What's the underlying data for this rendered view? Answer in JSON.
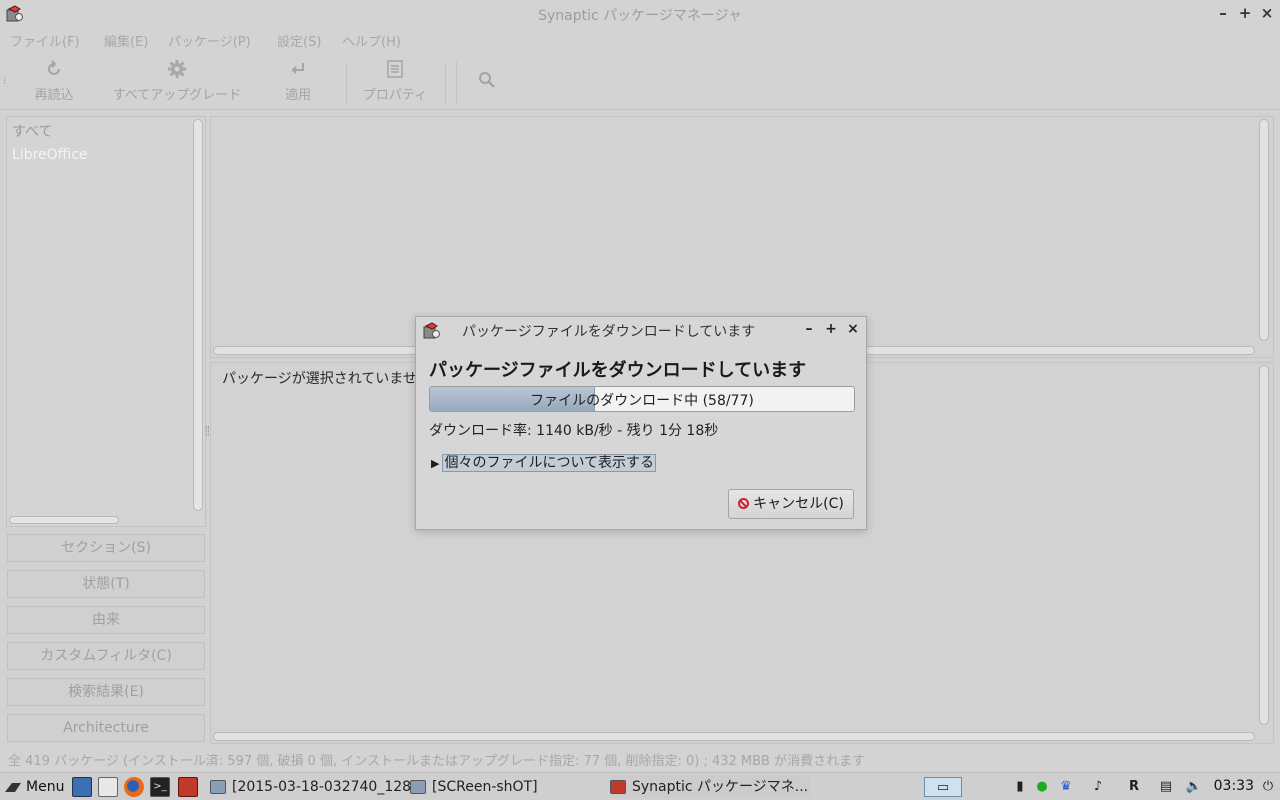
{
  "window": {
    "title": "Synaptic パッケージマネージャ",
    "controls": {
      "minimize": "–",
      "maximize": "+",
      "close": "×"
    }
  },
  "menubar": {
    "items": [
      "ファイル(F)",
      "編集(E)",
      "パッケージ(P)",
      "設定(S)",
      "ヘルプ(H)"
    ]
  },
  "toolbar": {
    "reload": "再読込",
    "upgrade_all": "すべてアップグレード",
    "apply": "適用",
    "properties": "プロパティ",
    "search_icon": "search-icon"
  },
  "sidebar": {
    "items": [
      "すべて",
      "LibreOffice"
    ],
    "filter_buttons": [
      "セクション(S)",
      "状態(T)",
      "由来",
      "カスタムフィルタ(C)",
      "検索結果(E)",
      "Architecture"
    ]
  },
  "details": {
    "text": "パッケージが選択されていません。"
  },
  "statusbar": {
    "text": "全 419 パッケージ (インストール済: 597 個, 破損 0 個, インストールまたはアップグレード指定: 77 個, 削除指定: 0) ; 432 MBB が消費されます"
  },
  "taskbar": {
    "menu_label": "Menu",
    "tasks": [
      "[2015-03-18-032740_128...",
      "[SCReen-shOT]",
      "Synaptic パッケージマネ..."
    ],
    "clock": "03:33"
  },
  "dialog": {
    "title": "パッケージファイルをダウンロードしています",
    "heading": "パッケージファイルをダウンロードしています",
    "progress_text": "ファイルのダウンロード中 (58/77)",
    "progress_fraction": 0.3896,
    "rate": "ダウンロード率: 1140 kB/秒 - 残り 1分 18秒",
    "expander": "個々のファイルについて表示する",
    "cancel": "キャンセル(C)",
    "controls": {
      "minimize": "–",
      "maximize": "+",
      "close": "×"
    }
  },
  "colors": {
    "progress_fill": "#a8b8ca",
    "cancel_icon": "#d0202a",
    "background": "#d2d2d2"
  }
}
